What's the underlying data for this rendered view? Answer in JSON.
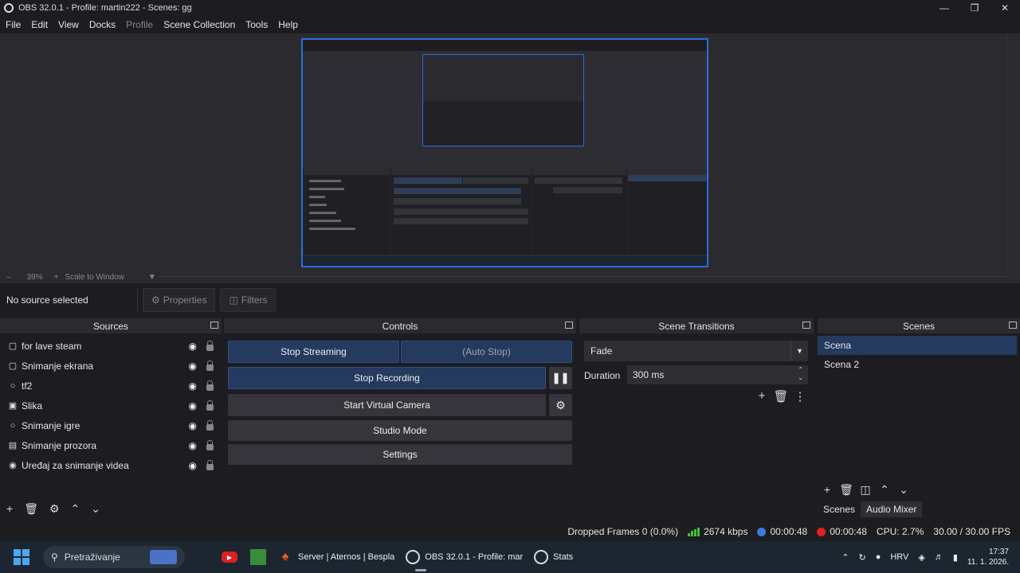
{
  "window": {
    "title": "OBS 32.0.1 - Profile: martin222 - Scenes: gg"
  },
  "menu": [
    "File",
    "Edit",
    "View",
    "Docks",
    "Profile",
    "Scene Collection",
    "Tools",
    "Help"
  ],
  "preview": {
    "zoom": "39%",
    "scale_mode": "Scale to Window"
  },
  "context": {
    "no_source": "No source selected",
    "properties": "Properties",
    "filters": "Filters"
  },
  "sources": {
    "title": "Sources",
    "items": [
      {
        "name": "for lave steam",
        "icon": "monitor-icon"
      },
      {
        "name": "Snimanje ekrana",
        "icon": "monitor-icon"
      },
      {
        "name": "tf2",
        "icon": "gamepad-icon"
      },
      {
        "name": "Slika",
        "icon": "image-icon"
      },
      {
        "name": "Snimanje igre",
        "icon": "gamepad-icon"
      },
      {
        "name": "Snimanje prozora",
        "icon": "window-icon"
      },
      {
        "name": "Uređaj za snimanje videa",
        "icon": "camera-icon"
      }
    ]
  },
  "controls": {
    "title": "Controls",
    "stop_streaming": "Stop Streaming",
    "auto_stop": "(Auto Stop)",
    "stop_recording": "Stop Recording",
    "start_virtual_camera": "Start Virtual Camera",
    "studio_mode": "Studio Mode",
    "settings": "Settings"
  },
  "transitions": {
    "title": "Scene Transitions",
    "selected": "Fade",
    "duration_label": "Duration",
    "duration_value": "300 ms"
  },
  "scenes": {
    "title": "Scenes",
    "items": [
      "Scena",
      "Scena 2"
    ],
    "selected": 0,
    "tabs": [
      "Scenes",
      "Audio Mixer"
    ]
  },
  "status": {
    "dropped_frames": "Dropped Frames 0 (0.0%)",
    "bitrate": "2674 kbps",
    "stream_time": "00:00:48",
    "record_time": "00:00:48",
    "cpu": "CPU: 2.7%",
    "fps": "30.00 / 30.00 FPS"
  },
  "taskbar": {
    "search": "Pretraživanje",
    "apps": [
      "Server | Aternos | Bespla",
      "OBS 32.0.1 - Profile: mar",
      "Stats"
    ],
    "lang": "HRV",
    "time": "17:37",
    "date": "11. 1. 2026."
  },
  "colors": {
    "accent": "#2a6edb",
    "selected_bg": "#243a5e",
    "record_red": "#e02020",
    "stream_blue": "#3a7bd5",
    "bitrate_green": "#3fbf3f"
  }
}
